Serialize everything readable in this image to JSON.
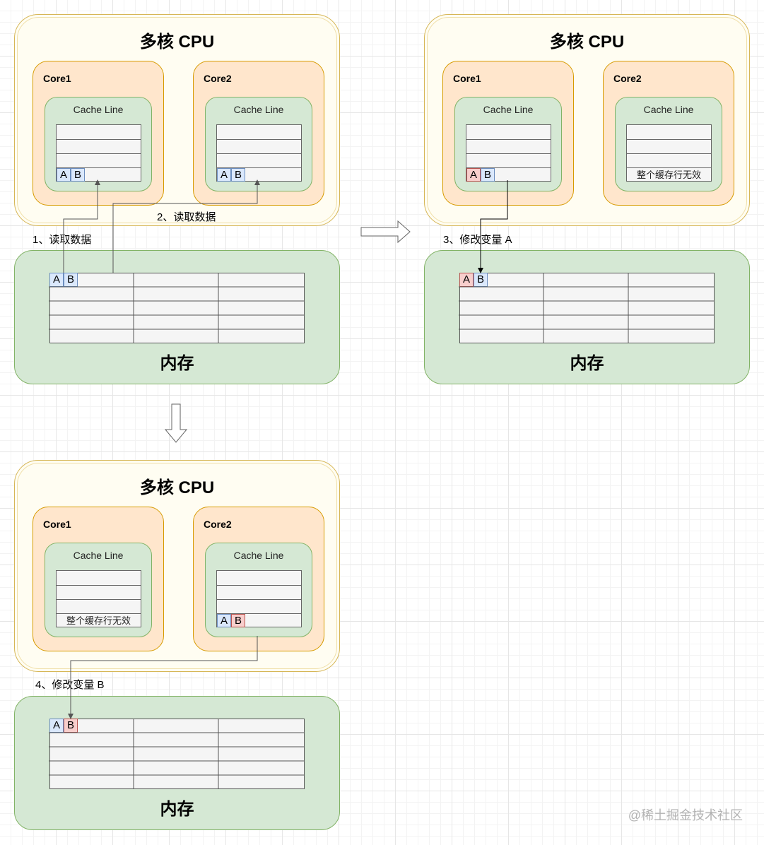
{
  "cpu_title": "多核 CPU",
  "memory_title": "内存",
  "core1_label": "Core1",
  "core2_label": "Core2",
  "cache_title": "Cache Line",
  "var_a": "A",
  "var_b": "B",
  "invalid_text": "整个缓存行无效",
  "steps": {
    "s1": "1、读取数据",
    "s2": "2、读取数据",
    "s3": "3、修改变量 A",
    "s4": "4、修改变量 B"
  },
  "watermark": "@稀土掘金技术社区",
  "colors": {
    "cpu_fill": "#fffdf2",
    "cpu_stroke": "#d6b656",
    "core_fill": "#ffe6cc",
    "core_stroke": "#d79b00",
    "cache_fill": "#d5e8d4",
    "cache_stroke": "#82b366",
    "var_normal": "#dae8fc",
    "var_modified": "#f8cecc"
  }
}
